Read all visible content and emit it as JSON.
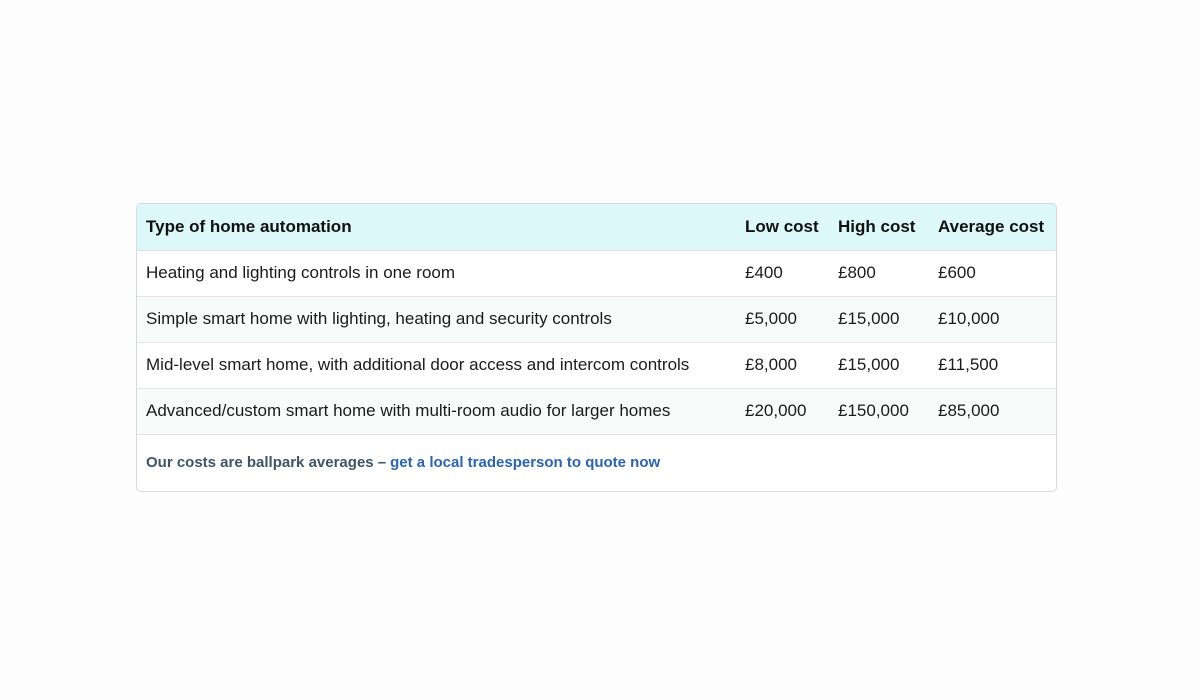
{
  "table": {
    "headers": [
      "Type of home automation",
      "Low cost",
      "High cost",
      "Average cost"
    ],
    "rows": [
      [
        "Heating and lighting controls in one room",
        "£400",
        "£800",
        "£600"
      ],
      [
        "Simple smart home with lighting, heating and security controls",
        "£5,000",
        "£15,000",
        "£10,000"
      ],
      [
        "Mid-level smart home, with additional door access and intercom controls",
        "£8,000",
        "£15,000",
        "£11,500"
      ],
      [
        "Advanced/custom smart home with multi-room audio for larger homes",
        "£20,000",
        "£150,000",
        "£85,000"
      ]
    ]
  },
  "footer": {
    "note": "Our costs are ballpark averages –",
    "link": "get a local tradesperson to quote now"
  },
  "colors": {
    "header_bg": "#dcf8f8",
    "link": "#2b63b5",
    "note": "#3e5566"
  }
}
